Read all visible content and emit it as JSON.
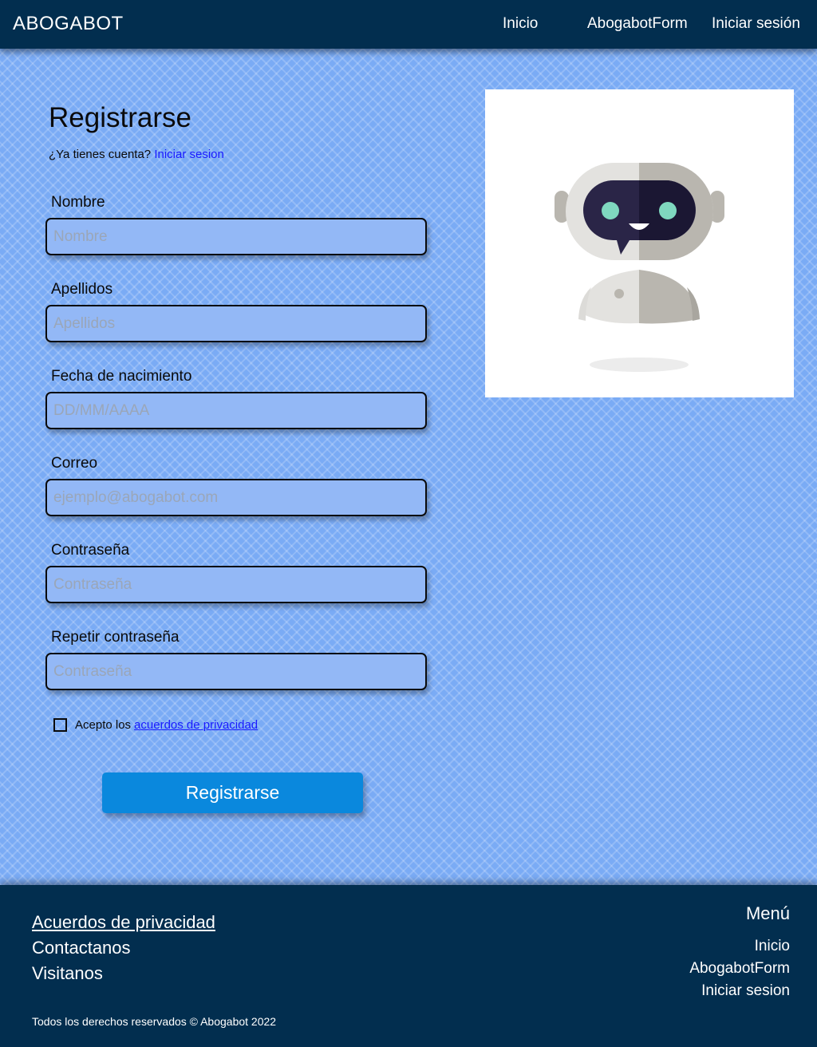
{
  "navbar": {
    "brand": "ABOGABOT",
    "links": [
      "Inicio",
      "AbogabotForm",
      "Iniciar sesión"
    ]
  },
  "form": {
    "title": "Registrarse",
    "login_prompt": "¿Ya tienes cuenta?",
    "login_link": "Iniciar sesion",
    "fields": [
      {
        "label": "Nombre",
        "placeholder": "Nombre"
      },
      {
        "label": "Apellidos",
        "placeholder": "Apellidos"
      },
      {
        "label": "Fecha de nacimiento",
        "placeholder": "DD/MM/AAAA"
      },
      {
        "label": "Correo",
        "placeholder": "ejemplo@abogabot.com"
      },
      {
        "label": "Contraseña",
        "placeholder": "Contraseña"
      },
      {
        "label": "Repetir contraseña",
        "placeholder": "Contraseña"
      }
    ],
    "consent_text": "Acepto los",
    "consent_link": "acuerdos de privacidad",
    "submit_label": "Registrarse"
  },
  "footer": {
    "links": [
      "Acuerdos de privacidad",
      "Contactanos",
      "Visitanos"
    ],
    "menu_heading": "Menú",
    "menu_links": [
      "Inicio",
      "AbogabotForm",
      "Iniciar sesion"
    ],
    "copyright": "Todos los derechos reservados © Abogabot 2022"
  },
  "colors": {
    "navbar_bg": "#022e4f",
    "page_bg": "#7aabf5",
    "input_bg": "#93b8f6",
    "button_bg": "#0a88dd",
    "link": "#1a1aff"
  }
}
